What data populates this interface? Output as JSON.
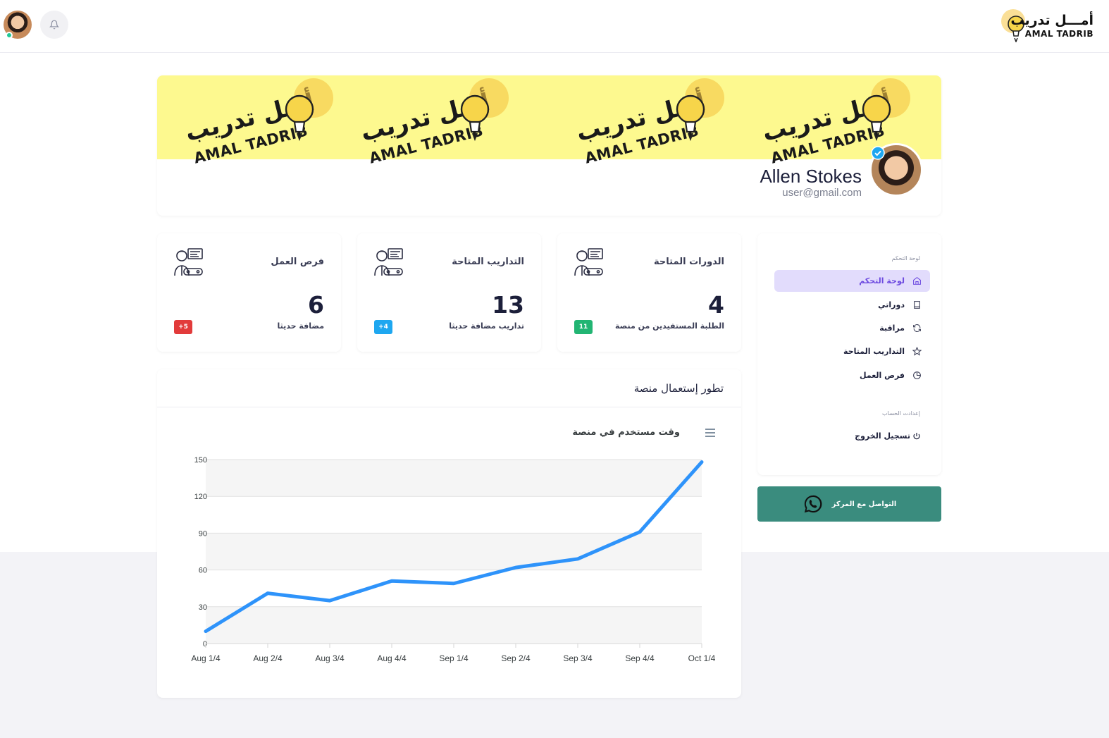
{
  "header": {
    "brand_ar": "أمـــل تدريب",
    "brand_en": "AMAL TADRIB"
  },
  "cover": {
    "tile_ar": "أمـل تدريب",
    "tile_en": "AMAL TADRIB"
  },
  "profile": {
    "name": "Allen Stokes",
    "email": "user@gmail.com"
  },
  "stats": [
    {
      "title": "الدورات المتاحة",
      "value": "4",
      "sub": "الطلبة المستفيدين من منصة",
      "badge": "11",
      "badge_color": "#22b573"
    },
    {
      "title": "التداريب المتاحة",
      "value": "13",
      "sub": "تداريب مضافة حديثا",
      "badge": "+4",
      "badge_color": "#1ea7f0"
    },
    {
      "title": "فرص العمل",
      "value": "6",
      "sub": "مضافة حديثا",
      "badge": "+5",
      "badge_color": "#e23b3b"
    }
  ],
  "sidebar": {
    "section_dashboard": "لوحة التحكم",
    "items": [
      {
        "label": "لوحة التحكم",
        "icon": "home-icon",
        "active": true
      },
      {
        "label": "دوراتي",
        "icon": "book-icon",
        "active": false
      },
      {
        "label": "مراقبة",
        "icon": "refresh-icon",
        "active": false
      },
      {
        "label": "التداريب المتاحة",
        "icon": "star-icon",
        "active": false
      },
      {
        "label": "فرص العمل",
        "icon": "pie-chart-icon",
        "active": false
      }
    ],
    "section_account": "إعدادت الحساب",
    "logout_label": "تسجيل الخروج"
  },
  "contact_button": "التواصل مع المركز",
  "chart_card": {
    "title": "تطور إستعمال منصة"
  },
  "chart_data": {
    "type": "line",
    "title": "وقت مستخدم في منصة",
    "categories": [
      "Aug 1/4",
      "Aug 2/4",
      "Aug 3/4",
      "Aug 4/4",
      "Sep 1/4",
      "Sep 2/4",
      "Sep 3/4",
      "Sep 4/4",
      "Oct 1/4"
    ],
    "series": [
      {
        "values": [
          10,
          41,
          35,
          51,
          49,
          62,
          69,
          91,
          148
        ]
      }
    ],
    "yticks": [
      0,
      30,
      60,
      90,
      120,
      150
    ],
    "ylim": [
      0,
      150
    ],
    "grid": true,
    "line_color": "#2e93fa"
  }
}
